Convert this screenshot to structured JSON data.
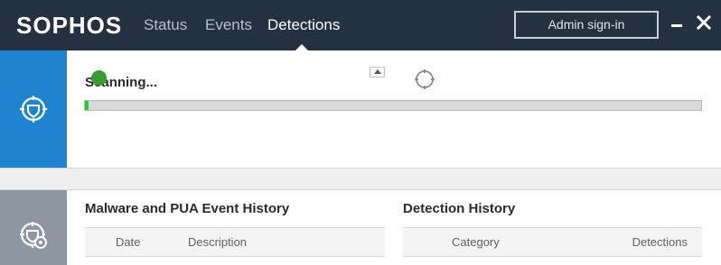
{
  "header": {
    "logo": "SOPHOS",
    "nav": [
      {
        "label": "Status"
      },
      {
        "label": "Events"
      },
      {
        "label": "Detections"
      }
    ],
    "active_nav": "Detections",
    "admin_button": "Admin sign-in",
    "background_color": "#233140"
  },
  "scanning": {
    "title": "Scanning...",
    "progress_fraction": 0.006,
    "accent_color": "#1f84cf",
    "progress_color": "#1ed133"
  },
  "history": {
    "malware_panel": {
      "title": "Malware and PUA Event History",
      "columns": [
        "Date",
        "Description"
      ]
    },
    "detection_panel": {
      "title": "Detection History",
      "columns": [
        "Category",
        "Detections"
      ]
    },
    "sidebar_color": "#8d96a1"
  },
  "icons": {
    "scan": "shield-target-icon",
    "history": "shield-settings-icon",
    "minimize": "minimize-icon",
    "close": "close-icon"
  }
}
